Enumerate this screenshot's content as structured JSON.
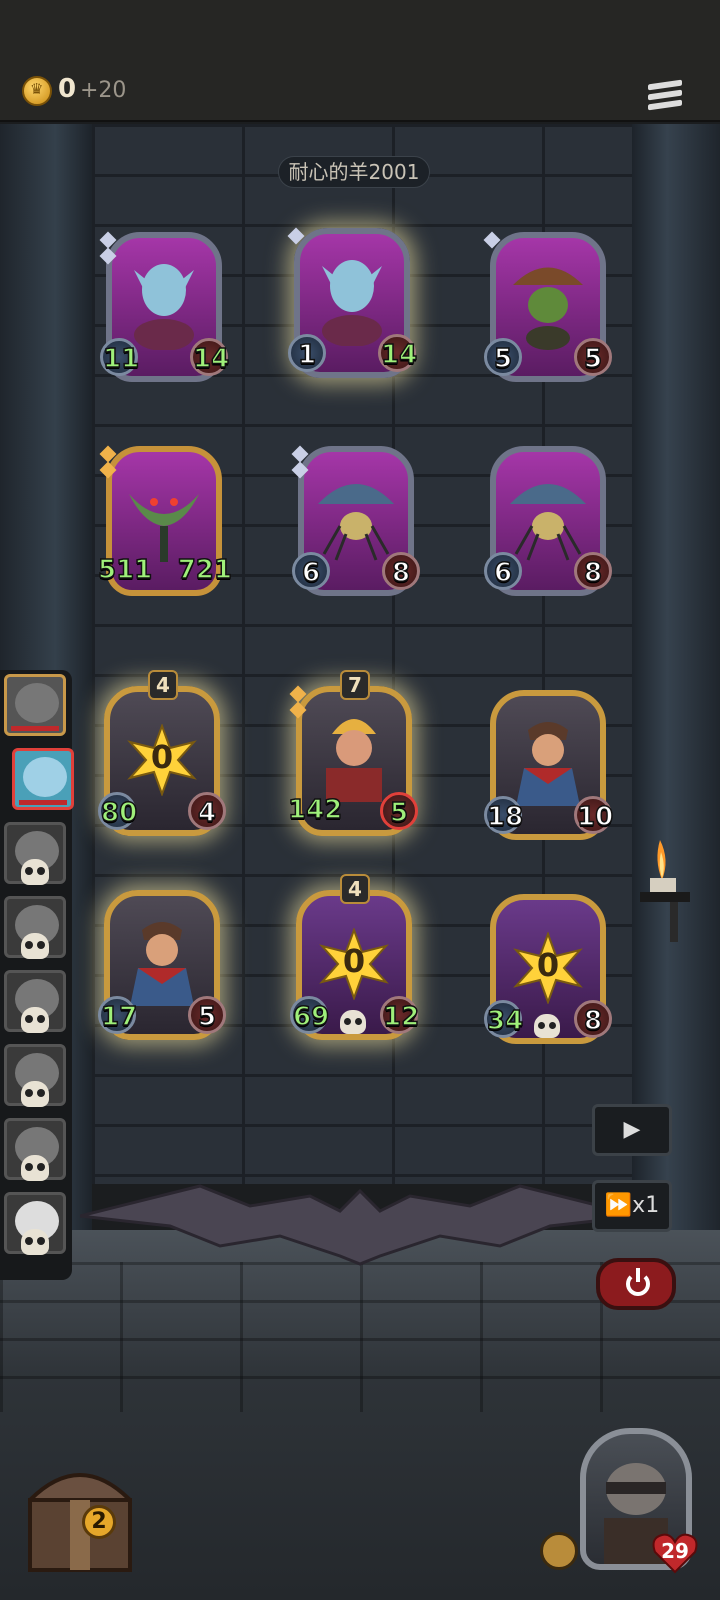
{
  "header": {
    "gold": "0",
    "gold_income": "+20",
    "opponent_name": "耐心的羊2001"
  },
  "board": {
    "enemy_row1": [
      {
        "attack": "11",
        "health": "14",
        "gems": 2
      },
      {
        "attack": "1",
        "health": "14",
        "gems": 1
      },
      {
        "attack": "5",
        "health": "5",
        "gems": 1
      }
    ],
    "enemy_row2": [
      {
        "attack": "511",
        "health": "721",
        "gems": 2
      },
      {
        "attack": "6",
        "health": "8",
        "gems": 2
      },
      {
        "attack": "6",
        "health": "8",
        "gems": 0
      }
    ],
    "player_row1": [
      {
        "level": "4",
        "burst": "0",
        "attack": "80",
        "health": "4"
      },
      {
        "level": "7",
        "attack": "142",
        "health": "5"
      },
      {
        "attack": "18",
        "health": "10"
      }
    ],
    "player_row2": [
      {
        "attack": "17",
        "health": "5"
      },
      {
        "level": "4",
        "burst": "0",
        "attack": "69",
        "health": "12"
      },
      {
        "burst": "0",
        "attack": "34",
        "health": "8"
      }
    ]
  },
  "controls": {
    "play_label": "▶",
    "speed_label": "⏩x1"
  },
  "player": {
    "chest_count": "2",
    "health": "29"
  },
  "roster": {
    "count": 8
  }
}
